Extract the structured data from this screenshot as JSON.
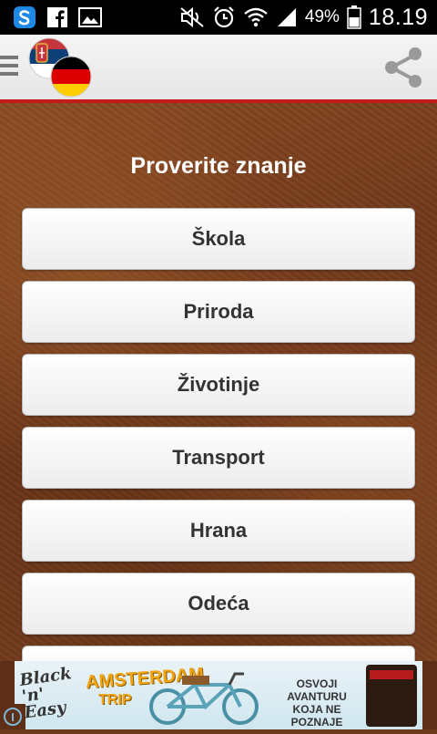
{
  "status_bar": {
    "battery_percent": "49%",
    "time": "18.19"
  },
  "title": "Proverite znanje",
  "categories": [
    "Škola",
    "Priroda",
    "Životinje",
    "Transport",
    "Hrana",
    "Odeća",
    ""
  ],
  "ad": {
    "brand": "Black 'n' Easy",
    "destination": "AMSTERDAM",
    "trip": "TRIP",
    "tagline": "OSVOJI AVANTURU KOJA NE POZNAJE GRANICE!"
  },
  "colors": {
    "accent_red": "#c31a1a",
    "title_text": "#ffffff",
    "button_text": "#333333"
  }
}
